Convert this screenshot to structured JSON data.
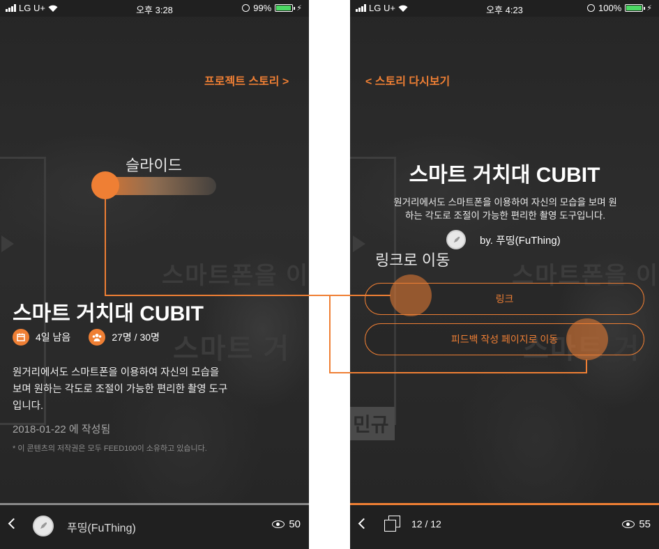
{
  "left": {
    "status": {
      "carrier": "LG U+",
      "time": "오후 3:28",
      "battery": "99%"
    },
    "top_link": "프로젝트 스토리 >",
    "bg_text_1": "스마트폰을 이",
    "bg_text_2": "스마트 거",
    "bg_tag": "민규",
    "title": "스마트 거치대 CUBIT",
    "days_left": "4일 남음",
    "people": "27명 / 30명",
    "description": "원거리에서도 스마트폰을 이용하여 자신의 모습을 보며 원하는 각도로 조절이 가능한 편리한 촬영 도구입니다.",
    "date": "2018-01-22 에 작성됨",
    "copyright": "* 이 콘텐츠의 저작권은 모두 FEED100이 소유하고 있습니다.",
    "author": "푸띵(FuThing)",
    "views": "50",
    "progress": 1.0
  },
  "right": {
    "status": {
      "carrier": "LG U+",
      "time": "오후 4:23",
      "battery": "100%"
    },
    "top_link": "< 스토리 다시보기",
    "bg_text_1": "스마트폰을 이",
    "bg_text_2": "스마트 거",
    "bg_tag": "민규",
    "title": "스마트 거치대 CUBIT",
    "description": "원거리에서도 스마트폰을 이용하여 자신의 모습을 보며 원하는 각도로 조절이 가능한 편리한 촬영 도구입니다.",
    "by": "by. 푸띵(FuThing)",
    "link_button": "링크",
    "feedback_button": "피드백 작성 페이지로 이동",
    "page_count": "12 / 12",
    "views": "55",
    "progress": 1.0
  },
  "annotations": {
    "slide": "슬라이드",
    "link_move": "링크로 이동"
  },
  "colors": {
    "accent": "#ef7f34",
    "background": "#2a2a2a",
    "bar": "#202020"
  }
}
